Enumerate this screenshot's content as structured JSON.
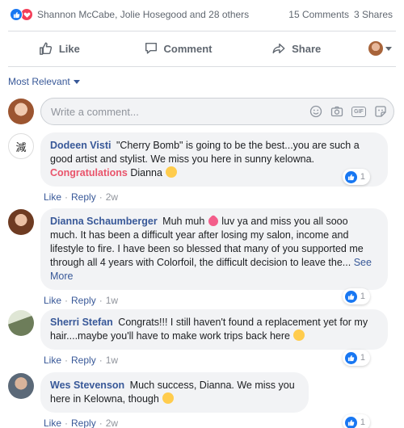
{
  "reactions": {
    "icons": [
      "like-icon",
      "love-icon"
    ],
    "names": "Shannon McCabe, Jolie Hosegood and 28 others",
    "comments": "15 Comments",
    "shares": "3 Shares"
  },
  "actions": {
    "like": "Like",
    "comment": "Comment",
    "share": "Share"
  },
  "sort": {
    "label": "Most Relevant"
  },
  "composer": {
    "placeholder": "Write a comment...",
    "icons": [
      "emoji-icon",
      "camera-icon",
      "gif-icon",
      "sticker-icon"
    ],
    "gif_label": "GIF"
  },
  "comments": [
    {
      "author": "Dodeen Visti",
      "text": "\"Cherry Bomb\" is going to be the best...you are such a good artist and stylist. We miss you here in sunny kelowna.",
      "highlight": "Congratulations",
      "text2": "Dianna",
      "emoji": "smile-emoji",
      "like": "Like",
      "reply": "Reply",
      "time": "2w",
      "likes": "1"
    },
    {
      "author": "Dianna Schaumberger",
      "text": "Muh muh",
      "emoji": "heart-emoji",
      "text2": "luv ya and miss you all sooo much. It has been a difficult year after losing my salon, income and lifestyle to fire. I have been so blessed that many of you supported me through all 4 years with Colorfoil, the difficult decision to leave the...",
      "see_more": "See More",
      "like": "Like",
      "reply": "Reply",
      "time": "1w",
      "likes": "1"
    },
    {
      "author": "Sherri Stefan",
      "text": "Congrats!!! I still haven't found a replacement yet for my hair....maybe you'll have to make work trips back here",
      "emoji": "wink-emoji",
      "like": "Like",
      "reply": "Reply",
      "time": "1w",
      "likes": "1"
    },
    {
      "author": "Wes Stevenson",
      "text": "Much success, Dianna. We miss you here in Kelowna, though",
      "emoji": "tear-emoji",
      "like": "Like",
      "reply": "Reply",
      "time": "2w",
      "likes": "1"
    }
  ],
  "colors": {
    "like_blue": "#1877f2",
    "love_red": "#f33e58",
    "link": "#385898",
    "highlight": "#e9546b"
  }
}
